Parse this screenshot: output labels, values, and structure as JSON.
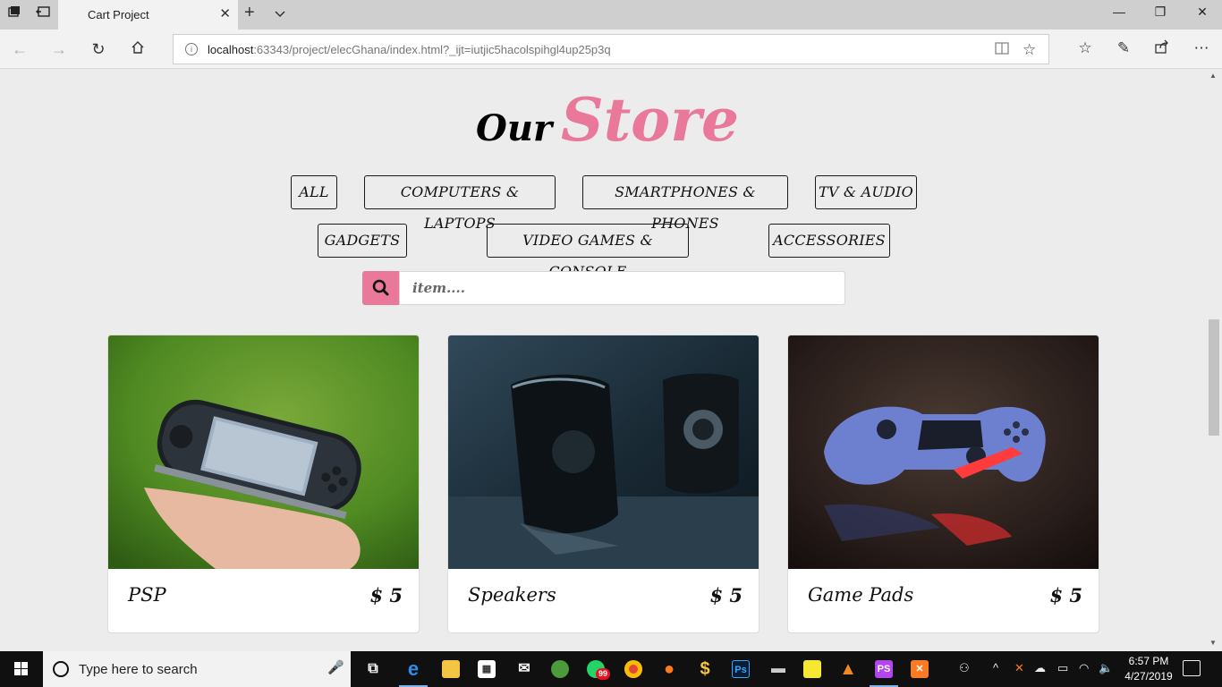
{
  "browser": {
    "tab_title": "Cart Project",
    "url_host": "localhost",
    "url_rest": ":63343/project/elecGhana/index.html?_ijt=iutjic5hacolspihgl4up25p3q"
  },
  "store": {
    "title_part1": "Our",
    "title_part2": "Store",
    "filters": [
      "All",
      "Computers & Laptops",
      "Smartphones & Phones",
      "TV & Audio",
      "Gadgets",
      "Video Games & Console",
      "Accessories"
    ],
    "search_placeholder": "item....",
    "products": [
      {
        "name": "PSP",
        "price": "$ 5"
      },
      {
        "name": "Speakers",
        "price": "$ 5"
      },
      {
        "name": "Game Pads",
        "price": "$ 5"
      }
    ]
  },
  "taskbar": {
    "search_placeholder": "Type here to search",
    "whatsapp_badge": "99",
    "time": "6:57 PM",
    "date": "4/27/2019"
  },
  "colors": {
    "accent_pink": "#e9789a",
    "page_bg": "#ececec",
    "taskbar_bg": "#101010"
  }
}
